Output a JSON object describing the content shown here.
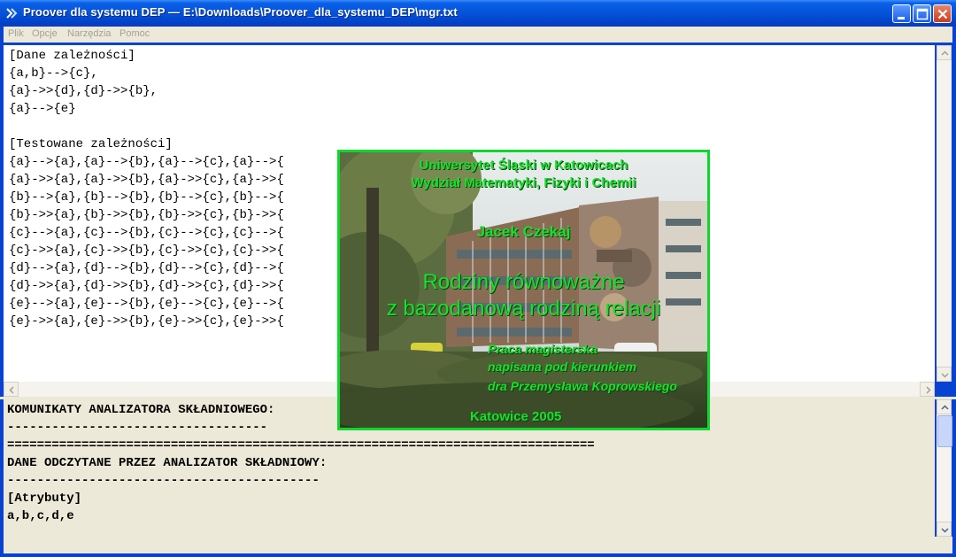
{
  "window": {
    "title": "Proover dla systemu DEP — E:\\Downloads\\Proover_dla_systemu_DEP\\mgr.txt"
  },
  "menu": [
    "Plik",
    "Opcje",
    "Narzędzia",
    "Pomoc"
  ],
  "editor": {
    "lines": [
      "[Dane zależności]",
      "{a,b}-->{c},",
      "{a}->>{d},{d}->>{b},",
      "{a}-->{e}",
      "",
      "[Testowane zależności]",
      "{a}-->{a},{a}-->{b},{a}-->{c},{a}-->{",
      "{a}->>{a},{a}->>{b},{a}->>{c},{a}->>{",
      "{b}-->{a},{b}-->{b},{b}-->{c},{b}-->{",
      "{b}->>{a},{b}->>{b},{b}->>{c},{b}->>{",
      "{c}-->{a},{c}-->{b},{c}-->{c},{c}-->{",
      "{c}->>{a},{c}->>{b},{c}->>{c},{c}->>{",
      "{d}-->{a},{d}-->{b},{d}-->{c},{d}-->{",
      "{d}->>{a},{d}->>{b},{d}->>{c},{d}->>{",
      "{e}-->{a},{e}-->{b},{e}-->{c},{e}-->{",
      "{e}->>{a},{e}->>{b},{e}->>{c},{e}->>{"
    ]
  },
  "messages": {
    "lines": [
      "KOMUNIKATY ANALIZATORA SKŁADNIOWEGO:",
      "-----------------------------------",
      "===============================================================================",
      "DANE ODCZYTANE PRZEZ ANALIZATOR SKŁADNIOWY:",
      "------------------------------------------",
      "[Atrybuty]",
      "a,b,c,d,e"
    ]
  },
  "splash": {
    "university": "Uniwersytet Śląski w Katowicach",
    "faculty": "Wydział Matematyki, Fizyki i Chemii",
    "author": "Jacek Czekaj",
    "title_line1": "Rodziny równoważne",
    "title_line2": "z bazodanową rodziną relacji",
    "thesis_line1": "Praca magisterska",
    "thesis_line2": "napisana pod kierunkiem",
    "thesis_line3": "dra Przemysława Koprowskiego",
    "place_year": "Katowice 2005"
  },
  "colors": {
    "titlebar": "#0453d8",
    "splash_text": "#18e02c",
    "splash_border": "#10d630"
  }
}
